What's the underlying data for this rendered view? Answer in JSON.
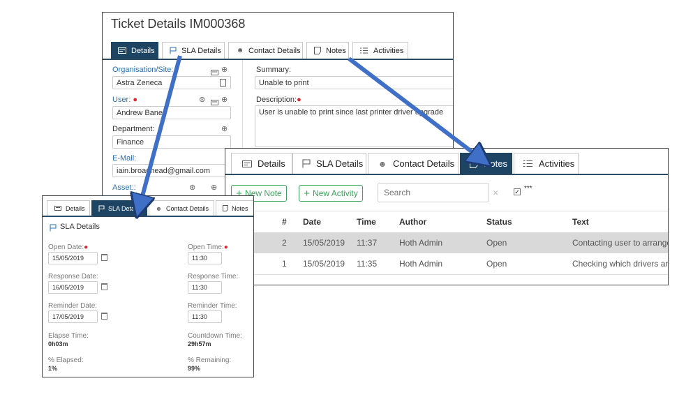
{
  "ticket": {
    "title": "Ticket Details IM000368",
    "tabs": [
      "Details",
      "SLA Details",
      "Contact Details",
      "Notes",
      "Activities"
    ],
    "fields": {
      "org_label": "Organisation/Site:",
      "org_value": "Astra Zeneca",
      "user_label": "User:",
      "user_value": "Andrew Banes",
      "dept_label": "Department:",
      "dept_value": "Finance",
      "email_label": "E-Mail:",
      "email_value": "iain.broadhead@gmail.com",
      "asset_label": "Asset::",
      "summary_label": "Summary:",
      "summary_value": "Unable to print",
      "description_label": "Description:",
      "description_value": "User is unable to print since last printer driver upgrade"
    }
  },
  "notes_panel": {
    "tabs": [
      "Details",
      "SLA Details",
      "Contact Details",
      "Notes",
      "Activities"
    ],
    "new_note_label": "New Note",
    "new_activity_label": "New Activity",
    "search_placeholder": "Search",
    "clear_symbol": "×",
    "mask_label": "***",
    "columns": [
      "#",
      "Date",
      "Time",
      "Author",
      "Status",
      "Text"
    ],
    "rows": [
      {
        "num": "2",
        "date": "15/05/2019",
        "time": "11:37",
        "author": "Hoth Admin",
        "status": "Open",
        "text": "Contacting user to arrange"
      },
      {
        "num": "1",
        "date": "15/05/2019",
        "time": "11:35",
        "author": "Hoth Admin",
        "status": "Open",
        "text": "Checking which drivers are"
      }
    ]
  },
  "sla_panel": {
    "tabs": [
      "Details",
      "SLA Details",
      "Contact Details",
      "Notes"
    ],
    "title": "SLA Details",
    "open_date_label": "Open Date:",
    "open_date": "15/05/2019",
    "open_time_label": "Open Time:",
    "open_time": "11:30",
    "response_date_label": "Response Date:",
    "response_date": "16/05/2019",
    "response_time_label": "Response Time:",
    "response_time": "11:30",
    "reminder_date_label": "Reminder Date:",
    "reminder_date": "17/05/2019",
    "reminder_time_label": "Reminder Time:",
    "reminder_time": "11:30",
    "elapse_label": "Elapse Time:",
    "elapse_value": "0h03m",
    "countdown_label": "Countdown Time:",
    "countdown_value": "29h57m",
    "elapsed_pct_label": "% Elapsed:",
    "elapsed_pct": "1%",
    "remaining_pct_label": "% Remaining:",
    "remaining_pct": "99%"
  },
  "colors": {
    "active_tab": "#1e4463",
    "label_blue": "#2a6fb0",
    "required_dot": "#d9262f",
    "green": "#3aa55a",
    "arrow": "#3f6fc6"
  }
}
